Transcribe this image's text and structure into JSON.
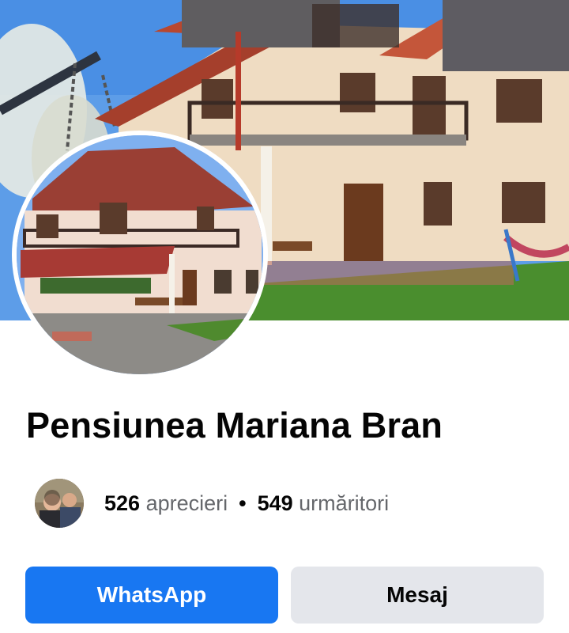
{
  "page": {
    "title": "Pensiunea Mariana Bran"
  },
  "stats": {
    "likes_count": "526",
    "likes_label": "aprecieri",
    "separator": "•",
    "followers_count": "549",
    "followers_label": "urmăritori"
  },
  "actions": {
    "whatsapp_label": "WhatsApp",
    "message_label": "Mesaj"
  },
  "colors": {
    "primary_button": "#1877f2",
    "secondary_button": "#e4e6eb",
    "title_text": "#050505",
    "secondary_text": "#65676b"
  },
  "images": {
    "cover": "guesthouse-cover-photo",
    "profile": "guesthouse-profile-photo",
    "avatar": "followers-avatar-photo"
  }
}
